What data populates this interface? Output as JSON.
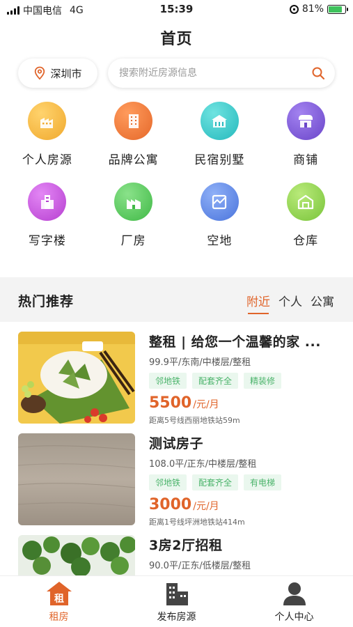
{
  "status_bar": {
    "carrier": "中国电信",
    "network": "4G",
    "time": "15:39",
    "battery": "81%",
    "battery_level": 0.81
  },
  "header": {
    "title": "首页"
  },
  "location": {
    "city": "深圳市"
  },
  "search": {
    "placeholder": "搜索附近房源信息",
    "value": ""
  },
  "categories": [
    {
      "label": "个人房源",
      "icon": "building-icon",
      "color": "#f1b33c"
    },
    {
      "label": "品牌公寓",
      "icon": "apartment-icon",
      "color": "#ee7d3a"
    },
    {
      "label": "民宿别墅",
      "icon": "villa-icon",
      "color": "#34c9c9"
    },
    {
      "label": "商铺",
      "icon": "shop-icon",
      "color": "#7b5bd6"
    },
    {
      "label": "写字楼",
      "icon": "office-building-icon",
      "color": "#c252d9"
    },
    {
      "label": "厂房",
      "icon": "factory-icon",
      "color": "#58c95d"
    },
    {
      "label": "空地",
      "icon": "land-icon",
      "color": "#5b85e6"
    },
    {
      "label": "仓库",
      "icon": "warehouse-icon",
      "color": "#8fd14a"
    }
  ],
  "recommend": {
    "title": "热门推荐",
    "tabs": [
      "附近",
      "个人",
      "公寓"
    ],
    "active_tab": "附近"
  },
  "listings": [
    {
      "title": "整租 | 给您一个温馨的家 ...",
      "specs": "99.9平/东南/中楼层/整租",
      "tags": [
        "邻地铁",
        "配套齐全",
        "精装修"
      ],
      "price": "5500",
      "price_unit": "/元/月",
      "distance": "距离5号线西丽地铁站59m"
    },
    {
      "title": "测试房子",
      "specs": "108.0平/正东/中楼层/整租",
      "tags": [
        "邻地铁",
        "配套齐全",
        "有电梯"
      ],
      "price": "3000",
      "price_unit": "/元/月",
      "distance": "距离1号线坪洲地铁站414m"
    },
    {
      "title": "3房2厅招租",
      "specs": "90.0平/正东/低楼层/整租",
      "tags": [],
      "price": "",
      "price_unit": "",
      "distance": ""
    }
  ],
  "bottom_nav": [
    {
      "label": "租房",
      "icon": "rent-house-icon",
      "active": true
    },
    {
      "label": "发布房源",
      "icon": "publish-building-icon",
      "active": false
    },
    {
      "label": "个人中心",
      "icon": "profile-icon",
      "active": false
    }
  ],
  "colors": {
    "accent": "#e0642a",
    "tag_text": "#4ab36a",
    "tag_bg": "#eaf7ee"
  }
}
